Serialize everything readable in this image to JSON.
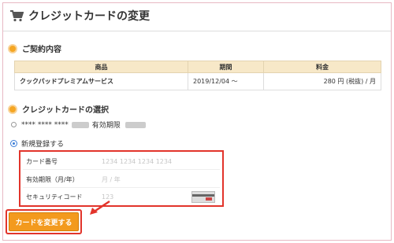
{
  "header": {
    "title": "クレジットカードの変更",
    "icon": "shopping-cart-icon"
  },
  "contract": {
    "heading": "ご契約内容",
    "columns": [
      "商品",
      "期間",
      "料金"
    ],
    "row": {
      "product": "クックパッドプレミアムサービス",
      "period": "2019/12/04 〜",
      "price": "280 円 (税抜) / 月"
    }
  },
  "card_selection": {
    "heading": "クレジットカードの選択",
    "existing": {
      "masked": "**** **** ****",
      "expiry_label": "有効期限",
      "selected": false
    },
    "new_card": {
      "label": "新規登録する",
      "selected": true
    }
  },
  "form": {
    "card_number": {
      "label": "カード番号",
      "placeholder": "1234 1234 1234 1234"
    },
    "expiry": {
      "label": "有効期限（月/年）",
      "placeholder": "月 / 年"
    },
    "security_code": {
      "label": "セキュリティコード",
      "placeholder": "123",
      "icon": "card-back-icon"
    }
  },
  "submit": {
    "label": "カードを変更する"
  },
  "colors": {
    "accent": "#f39a1e",
    "highlight": "#e2342b",
    "table_header": "#f7e8c8"
  }
}
